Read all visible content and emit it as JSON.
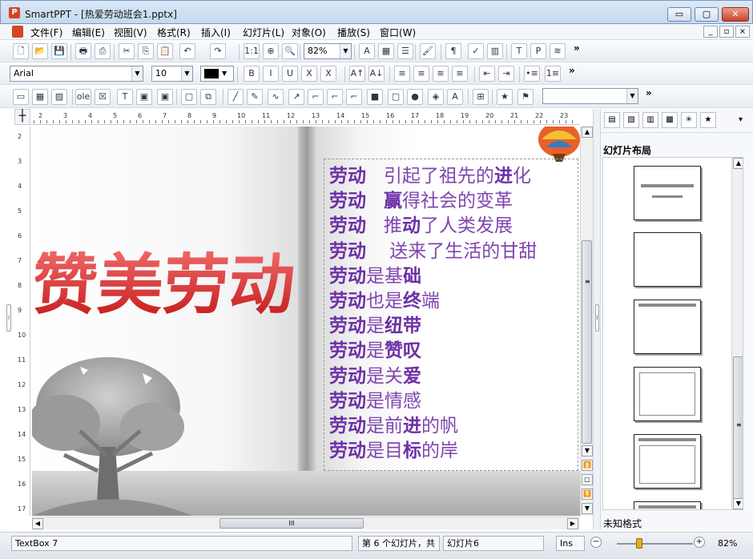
{
  "window": {
    "title": "SmartPPT - [热爱劳动班会1.pptx]",
    "app_glyph": "P",
    "min_glyph": "▭",
    "max_glyph": "▢",
    "close_glyph": "✕"
  },
  "menu": {
    "items": [
      "文件(F)",
      "编辑(E)",
      "视图(V)",
      "格式(R)",
      "插入(I)",
      "幻灯片(L)",
      "对象(O)",
      "播放(S)",
      "窗口(W)"
    ],
    "mdi_min": "_",
    "mdi_restore": "▫",
    "mdi_close": "×"
  },
  "toolbar1": {
    "zoom_value": "82%",
    "more": "»",
    "icons": [
      "new-icon",
      "open-icon",
      "save-icon",
      "print-icon",
      "pdf-icon",
      "cut-icon",
      "copy-icon",
      "paste-icon",
      "undo-icon",
      "redo-icon",
      "actual-size-icon",
      "zoom-in-icon",
      "find-icon",
      "font-color-icon",
      "slide-icon",
      "notes-icon",
      "format-painter-icon",
      "paragraph-icon",
      "spell-check-icon",
      "chart-icon",
      "slide-view-icon",
      "print-preview-icon",
      "layers-icon"
    ],
    "glyphs": [
      "🗋",
      "📂",
      "💾",
      "🖶",
      "⎙",
      "✂",
      "⎘",
      "📋",
      "↶",
      "↷",
      "1:1",
      "⊕",
      "🔍",
      "A",
      "▦",
      "☰",
      "🖌",
      "¶",
      "✓",
      "▥",
      "T",
      "P",
      "≋"
    ]
  },
  "toolbar2": {
    "font_name": "Arial",
    "font_size": "10",
    "color": "#000000",
    "more": "»",
    "icons": [
      "bold-icon",
      "italic-icon",
      "underline-icon",
      "strikethrough-icon",
      "clear-format-icon",
      "grow-font-icon",
      "shrink-font-icon",
      "align-left-icon",
      "align-center-icon",
      "align-right-icon",
      "justify-icon",
      "decrease-indent-icon",
      "increase-indent-icon",
      "bullets-icon",
      "numbering-icon"
    ],
    "glyphs": [
      "B",
      "I",
      "U",
      "X",
      "X",
      "A↑",
      "A↓",
      "≡",
      "≡",
      "≡",
      "≡",
      "⇤",
      "⇥",
      "•≡",
      "1≡"
    ]
  },
  "toolbar3": {
    "more": "»",
    "style_value": "",
    "icons": [
      "textbox-icon",
      "table-icon",
      "image-icon",
      "ole-icon",
      "symbol-icon",
      "textframe-icon",
      "frame-icon",
      "picture-frame-icon",
      "select-icon",
      "group-icon",
      "line-icon",
      "pencil-icon",
      "curve-icon",
      "arrow-icon",
      "connector-icon",
      "connector2-icon",
      "connector3-icon",
      "rectangle-icon",
      "rounded-rect-icon",
      "ellipse-icon",
      "shape-icon",
      "wordart-icon",
      "align-icon",
      "star-icon",
      "bookmark-icon"
    ],
    "glyphs": [
      "▭",
      "▦",
      "▨",
      "ole",
      "☒",
      "T",
      "▣",
      "▣",
      "▢",
      "⧉",
      "╱",
      "✎",
      "∿",
      "↗",
      "⌐",
      "⌐",
      "⌐",
      "■",
      "▢",
      "●",
      "◈",
      "A",
      "⊞",
      "★",
      "⚑"
    ]
  },
  "ruler": {
    "corner": "┼",
    "h_numbers": [
      "2",
      "3",
      "4",
      "5",
      "6",
      "7",
      "8",
      "9",
      "10",
      "11",
      "12",
      "13",
      "14",
      "15",
      "16",
      "17",
      "18",
      "19",
      "20",
      "21",
      "22",
      "23"
    ],
    "v_numbers": [
      "2",
      "3",
      "4",
      "5",
      "6",
      "7",
      "8",
      "9",
      "10",
      "11",
      "12",
      "13",
      "14",
      "15",
      "16",
      "17"
    ]
  },
  "slide": {
    "title_art": "赞美劳动",
    "lines": [
      {
        "a": "劳动",
        "b": "   引起了祖先的",
        "c": "进",
        "d": "化"
      },
      {
        "a": "劳动",
        "b": "   ",
        "c": "赢",
        "d": "得社会的变革"
      },
      {
        "a": "劳动",
        "b": "   推",
        "c": "动",
        "d": "了人类发展"
      },
      {
        "a": "劳动",
        "b": "    送来了生活的甘甜",
        "c": "",
        "d": ""
      },
      {
        "a": "劳动",
        "b": "是基",
        "c": "础",
        "d": ""
      },
      {
        "a": "劳动",
        "b": "也是",
        "c": "终",
        "d": "端"
      },
      {
        "a": "劳动",
        "b": "是",
        "c": "纽带",
        "d": ""
      },
      {
        "a": "劳动",
        "b": "是",
        "c": "赞叹",
        "d": ""
      },
      {
        "a": "劳动",
        "b": "是关",
        "c": "爱",
        "d": ""
      },
      {
        "a": "劳动",
        "b": "是情感",
        "c": "",
        "d": ""
      },
      {
        "a": "劳动",
        "b": "是前",
        "c": "进",
        "d": "的帆"
      },
      {
        "a": "劳动",
        "b": "是目",
        "c": "标",
        "d": "的岸"
      }
    ]
  },
  "scroll": {
    "up": "▲",
    "down": "▼",
    "left": "◀",
    "right": "▶",
    "grip_h": "III",
    "grip_v": "≡",
    "prev_slide": "⏫",
    "next_slide": "⏬",
    "fit": "▢",
    "splitter_grip": "⁞"
  },
  "panel": {
    "title": "幻灯片布局",
    "format_label": "未知格式",
    "icons": [
      "layout-icon",
      "design-icon",
      "color-scheme-icon",
      "background-icon",
      "transition-icon",
      "animation-icon"
    ],
    "glyphs": [
      "▤",
      "▧",
      "▥",
      "▩",
      "✳",
      "★"
    ],
    "dropdown": "▾"
  },
  "status": {
    "object": "TextBox 7",
    "slide_info": "第 6 个幻灯片，共",
    "slide_name": "幻灯片6",
    "mode": "Ins",
    "zoom": "82%",
    "zoom_minus": "−",
    "zoom_plus": "+"
  }
}
